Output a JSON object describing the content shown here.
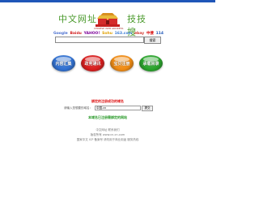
{
  "brand": {
    "name_left": "中文网址",
    "name_right": "技技搜",
    "gate_caption": "CHINESE WEB ADDRESS"
  },
  "engines": [
    {
      "label": "Google",
      "color": "#4a6fd0"
    },
    {
      "label": "Baidu",
      "color": "#d12020"
    },
    {
      "label": "YAHOO!",
      "color": "#7b0099"
    },
    {
      "label": "Sohu",
      "color": "#e0a000"
    },
    {
      "label": "163.com",
      "color": "#3a7bd5"
    },
    {
      "label": "ebay",
      "color": "#d2352b"
    },
    {
      "label": "中搜",
      "color": "#d60000"
    },
    {
      "label": "114",
      "color": "#1f56b8"
    }
  ],
  "search": {
    "value": "",
    "button_label": "搜索"
  },
  "orbs": [
    {
      "label": "内容汇集",
      "color": "#2f6fd0"
    },
    {
      "label": "政务通讯",
      "color": "#d81c1c"
    },
    {
      "label": "宝贝注册",
      "color": "#ef8a12"
    },
    {
      "label": "承载目录",
      "color": "#28a32a"
    }
  ],
  "notice": {
    "heading": "绑定的注册成功的域名",
    "prompt": "请输入您想要的域名：",
    "domain_value": "中国.cn",
    "domain_button": "提交",
    "tip": "本域名已注册需绑定的网站"
  },
  "footer": {
    "line1": "中文网址  联系我们",
    "line2": "版权所有 www.cn.cn.com",
    "line3": "国家中文 ICP 备案号 请勿用于商业用途 服务热线"
  }
}
